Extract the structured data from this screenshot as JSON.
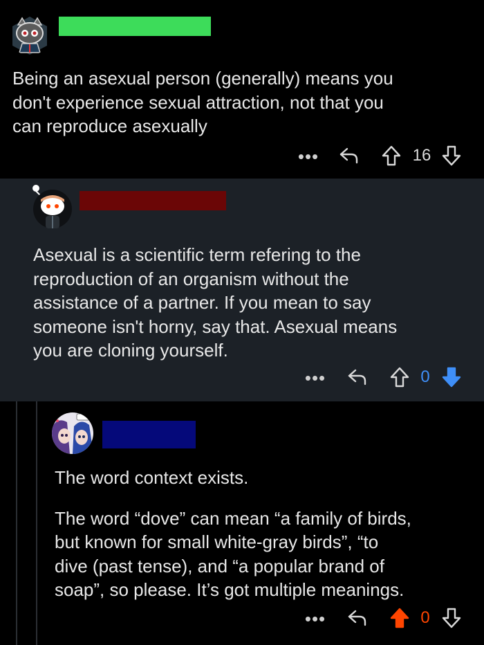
{
  "comments": [
    {
      "text_lines": [
        "Being an asexual person (generally) means you",
        "don't experience sexual attraction, not that you",
        "can reproduce asexually"
      ],
      "redact_color": "#3ddc5a",
      "score": "16",
      "vote_state": "none",
      "avatar": "cat-hoodie-avatar"
    },
    {
      "text_lines": [
        "Asexual is a scientific term refering to the",
        "reproduction of an organism without the",
        "assistance of a partner. If you mean to say",
        "someone isn't horny, say that. Asexual means",
        "you are cloning yourself."
      ],
      "redact_color": "#6b0606",
      "score": "0",
      "vote_state": "downvoted",
      "avatar": "snoo-avatar"
    },
    {
      "paragraph1": "The word context exists.",
      "text_lines": [
        "The word “dove” can mean “a family of birds,",
        "but known for small white-gray birds”, “to",
        "dive (past tense), and “a popular brand of",
        "soap”, so please. It’s got multiple meanings."
      ],
      "redact_color": "#05097a",
      "score": "0",
      "vote_state": "upvoted",
      "avatar": "anime-duo-avatar"
    }
  ],
  "actions": {
    "more_label": "•••"
  },
  "colors": {
    "upvote_active": "#ff4500",
    "downvote_active": "#3f8ff8",
    "icon_default": "#d9d9d9"
  }
}
